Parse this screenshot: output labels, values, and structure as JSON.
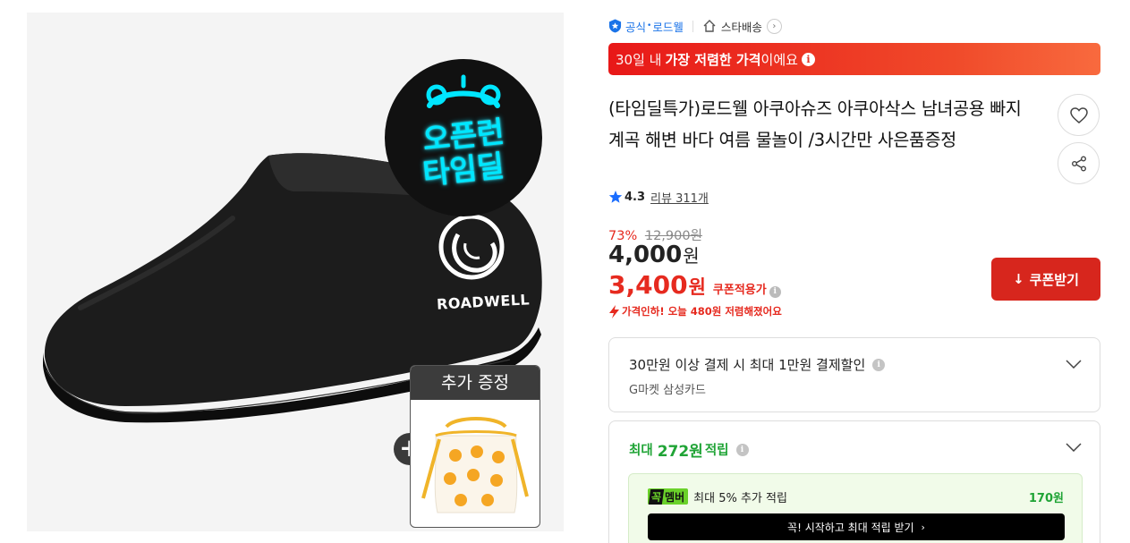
{
  "image": {
    "badge_line1": "오픈런",
    "badge_line2": "타임딜",
    "brand_label": "ROADWELL",
    "gift_header": "추가 증정",
    "plus_symbol": "+"
  },
  "store": {
    "official": "공식",
    "dot": "•",
    "name": "로드웰",
    "delivery": "스타배송",
    "chevron": "›"
  },
  "banner": {
    "pre": "30일 내",
    "strong": "가장 저렴한 가격",
    "post": "이에요",
    "info": "i"
  },
  "product": {
    "title": "(타임딜특가)로드웰 아쿠아슈즈 아쿠아삭스 남녀공용 빠지 계곡 해변 바다 여름 물놀이 /3시간만 사은품증정"
  },
  "rating": {
    "value": "4.3",
    "review_label": "리뷰 311개"
  },
  "price": {
    "discount_rate": "73%",
    "original": "12,900원",
    "sale_amount": "4,000",
    "sale_unit": "원",
    "coupon_amount": "3,400",
    "coupon_unit": "원",
    "coupon_label": "쿠폰적용가",
    "info": "i",
    "drop_notice": "가격인하! 오늘 480원 저렴해졌어요"
  },
  "coupon_button": {
    "icon": "↓",
    "label": "쿠폰받기"
  },
  "card_benefit": {
    "title": "30만원 이상 결제 시 최대 1만원 결제할인",
    "subtitle": "G마켓 삼성카드",
    "info": "i"
  },
  "points": {
    "prefix": "최대",
    "amount": "272원",
    "suffix": "적립",
    "info": "i",
    "member_badge_1": "꼭",
    "member_badge_2": "멤버",
    "member_text": "최대 5% 추가 적립",
    "member_amount": "170원",
    "cta_label": "꼭! 시작하고 최대 적립 받기",
    "cta_arrow": "›"
  },
  "colors": {
    "accent_red": "#e62a1f",
    "coupon_button": "#d7261d",
    "points_green": "#20a436",
    "official_blue": "#1a73e8"
  }
}
